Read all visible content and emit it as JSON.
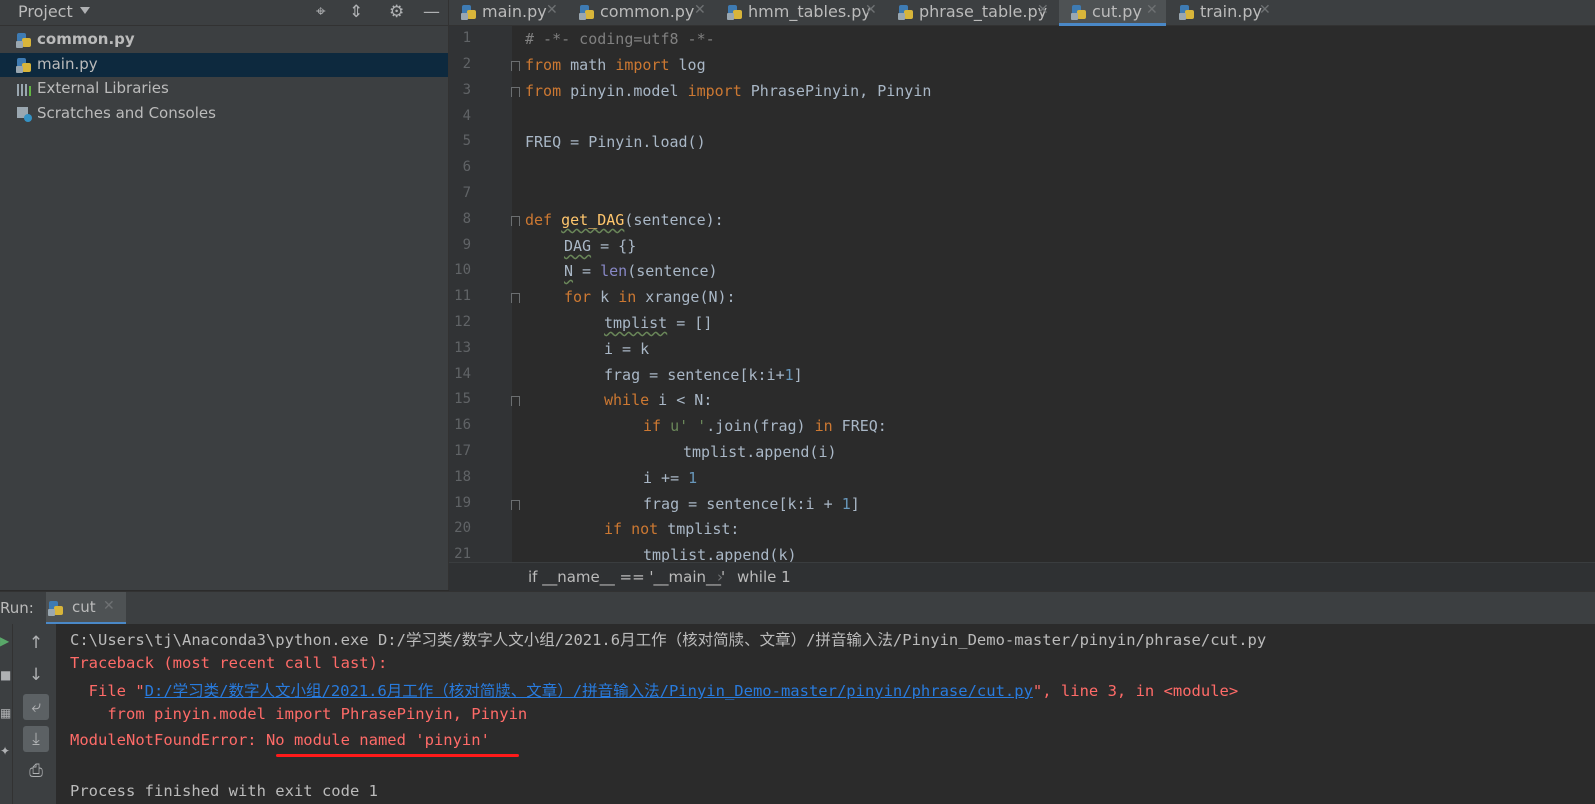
{
  "project_panel": {
    "title": "Project",
    "tree": [
      {
        "label": "common.py",
        "bold": true,
        "icon": "python-file-icon"
      },
      {
        "label": "main.py",
        "selected": true,
        "icon": "python-file-icon"
      },
      {
        "label": "External Libraries",
        "icon": "library-icon"
      },
      {
        "label": "Scratches and Consoles",
        "icon": "scratches-icon"
      }
    ]
  },
  "tabs": [
    {
      "label": "main.py",
      "active": false
    },
    {
      "label": "common.py",
      "active": false
    },
    {
      "label": "hmm_tables.py",
      "active": false
    },
    {
      "label": "phrase_table.py",
      "active": false
    },
    {
      "label": "cut.py",
      "active": true
    },
    {
      "label": "train.py",
      "active": false
    }
  ],
  "editor": {
    "line_numbers": [
      "1",
      "2",
      "3",
      "4",
      "5",
      "6",
      "7",
      "8",
      "9",
      "10",
      "11",
      "12",
      "13",
      "14",
      "15",
      "16",
      "17",
      "18",
      "19",
      "20",
      "21"
    ],
    "lines": {
      "l1_comment": "# -*- coding=utf8 -*-",
      "l2_from": "from",
      "l2_mod": " math ",
      "l2_import": "import",
      "l2_name": " log",
      "l3_from": "from",
      "l3_mod": " pinyin.model ",
      "l3_import": "import",
      "l3_names": " PhrasePinyin, Pinyin",
      "l5": "FREQ = Pinyin.load()",
      "l8_def": "def",
      "l8_sp": " ",
      "l8_fn": "get_DAG",
      "l8_rest": "(sentence):",
      "l9_var": "DAG",
      "l9_rest": " = {}",
      "l10_var": "N",
      "l10_eq": " = ",
      "l10_bi": "len",
      "l10_rest": "(sentence)",
      "l11_for": "for",
      "l11_mid": " k ",
      "l11_in": "in",
      "l11_rest": " xrange(N):",
      "l12_var": "tmplist",
      "l12_rest": " = []",
      "l13": "i = k",
      "l14_a": "frag = sentence[k:i+",
      "l14_num": "1",
      "l14_b": "]",
      "l15_kw": "while",
      "l15_rest": " i < N:",
      "l16_if": "if",
      "l16_str": " u' '",
      "l16_mid": ".join(frag) ",
      "l16_in": "in",
      "l16_rest": " FREQ:",
      "l17": "tmplist.append(i)",
      "l18_a": "i += ",
      "l18_num": "1",
      "l19_a": "frag = sentence[k:i + ",
      "l19_num": "1",
      "l19_b": "]",
      "l20_if": "if",
      "l20_not": " not",
      "l20_rest": " tmplist:",
      "l21": "tmplist.append(k)"
    }
  },
  "breadcrumb": {
    "item1": "if __name__ == '__main__'",
    "separator": "›",
    "item2": "while 1"
  },
  "run_panel": {
    "label": "Run:",
    "tab_label": "cut",
    "console": {
      "cmd": "C:\\Users\\tj\\Anaconda3\\python.exe D:/学习类/数字人文小组/2021.6月工作（核对简牍、文章）/拼音输入法/Pinyin_Demo-master/pinyin/phrase/cut.py",
      "traceback": "Traceback (most recent call last):",
      "file_prefix": "  File \"",
      "file_link": "D:/学习类/数字人文小组/2021.6月工作（核对简牍、文章）/拼音输入法/Pinyin_Demo-master/pinyin/phrase/cut.py",
      "file_suffix": "\", line 3, in <module>",
      "code_line": "    from pinyin.model import PhrasePinyin, Pinyin",
      "error_type": "ModuleNotFoundError: ",
      "error_msg": "No module named 'pinyin'",
      "process_done": "Process finished with exit code 1"
    }
  },
  "colors": {
    "keyword": "#cc7832",
    "error": "#ff6b68",
    "link": "#287bde",
    "annotation": "#ff1a1a",
    "accent": "#4a88c7"
  }
}
